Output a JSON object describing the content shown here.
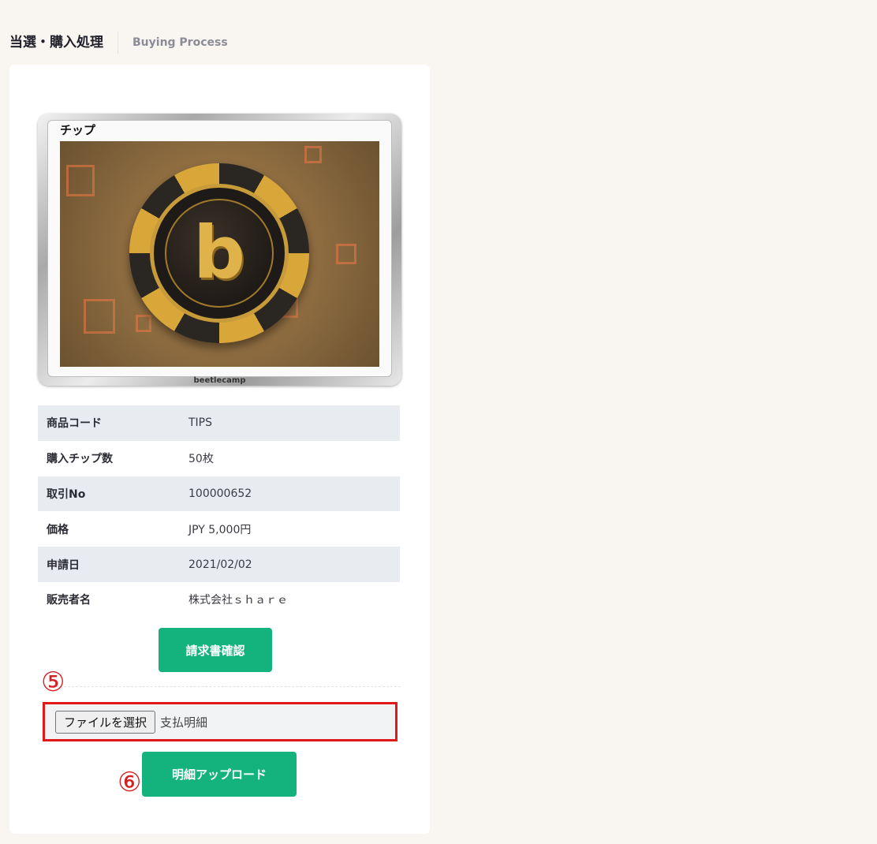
{
  "header": {
    "title": "当選・購入処理",
    "subtitle": "Buying Process"
  },
  "product_image": {
    "label": "チップ",
    "brand": "beetlecamp",
    "chip_letter": "b"
  },
  "details": [
    {
      "key": "商品コード",
      "value": "TIPS"
    },
    {
      "key": "購入チップ数",
      "value": "50枚"
    },
    {
      "key": "取引No",
      "value": "100000652"
    },
    {
      "key": "価格",
      "value": "JPY 5,000円"
    },
    {
      "key": "申請日",
      "value": "2021/02/02"
    },
    {
      "key": "販売者名",
      "value": "株式会社ｓｈａｒｅ"
    }
  ],
  "actions": {
    "invoice_label": "請求書確認",
    "file_button_label": "ファイルを選択",
    "file_name": "支払明細",
    "upload_label": "明細アップロード"
  },
  "annotations": {
    "step5": "⑤",
    "step6": "⑥"
  },
  "colors": {
    "accent": "#14b27d",
    "highlight": "#e01818",
    "background": "#f9f5f0"
  }
}
